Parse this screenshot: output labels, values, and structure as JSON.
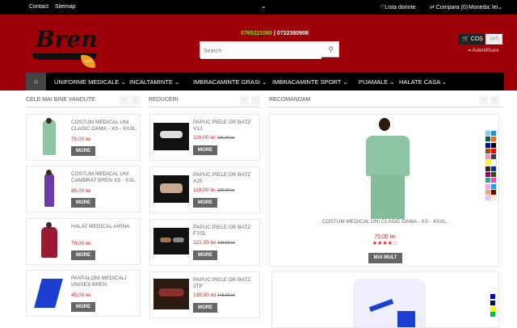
{
  "topbar": {
    "contact": "Contact",
    "sitemap": "Sitemap",
    "wishlist": "Lista dorinte",
    "compare": "Compara (0)",
    "currency": "Moneda: lei"
  },
  "header": {
    "logo_text": "Bren",
    "logo_badge": "MAG",
    "phone1": "0765221060",
    "phone_sep": " | ",
    "phone2": "0722380908",
    "search_placeholder": "Search",
    "cart_label": "COȘ",
    "cart_status": "(gol)",
    "login": "Autentificare"
  },
  "nav": {
    "items": [
      "UNIFORME MEDICALE",
      "INCALTAMINTE",
      "IMBRACAMINTE GRASI",
      "IMBRACAMINTE SPORT",
      "PIJAMALE",
      "HALATE CASA"
    ]
  },
  "bestsellers": {
    "title": "CELE MAI BINE VANDUTE",
    "items": [
      {
        "name": "COSTUM MEDICAL UNI CLASIC DAMA - XS - XXXL.",
        "price": "75,00 lei",
        "button": "MORE"
      },
      {
        "name": "COSTUM MEDICAL UNI CAMBRAT BREN XS - XXL",
        "price": "85,00 lei",
        "button": "MORE"
      },
      {
        "name": "HALAT MEDICAL IARNA",
        "price": "79,00 lei",
        "button": "MORE"
      },
      {
        "name": "PANTALONI MEDICALI UNISEX BREN",
        "price": "45,00 lei",
        "button": "MORE"
      }
    ]
  },
  "discounts": {
    "title": "REDUCERI",
    "items": [
      {
        "name": "PAPUC PIELE DR BATZ V13",
        "price": "116,00 lei",
        "old_price": "126,00 lei",
        "button": "MORE"
      },
      {
        "name": "PAPUC PIELE DR BATZ A25",
        "price": "118,00 lei",
        "old_price": "128,00 lei",
        "button": "MORE"
      },
      {
        "name": "PAPUC PIELE DR BATZ FT05",
        "price": "122,00 lei",
        "old_price": "132,00 lei",
        "button": "MORE"
      },
      {
        "name": "PAPUC PIELE DR BATZ 3TP",
        "price": "138,00 lei",
        "old_price": "148,00 lei",
        "button": "MORE"
      }
    ]
  },
  "recommended": {
    "title": "RECOMANDAM",
    "product": {
      "name": "COSTUM MEDICAL UNI CLASIC DAMA - XS - XXXL.",
      "price": "75,00 lei",
      "rating": 4,
      "rating_max": 5,
      "button": "MAI MULT",
      "colors": [
        "#8fc4f0",
        "#1a9ab8",
        "#006060",
        "#ff6020",
        "#0000c0",
        "#000000",
        "#a05000",
        "#ff0000",
        "#ff90b0",
        "#404040",
        "#ffff00",
        "#ffffff",
        "#402010",
        "#003090",
        "#a00080",
        "#305000",
        "#20b090",
        "#ff40c0",
        "#ffa0f0",
        "#00b0f0",
        "#ffa070",
        "#700000",
        "#d8c8f8",
        "#fff0c0"
      ]
    },
    "product2": {
      "colors": [
        "#ffffff",
        "#0000c0",
        "#001040",
        "#ffff00",
        "#00c040"
      ]
    }
  },
  "colors": {
    "header_red": "#9e0008",
    "price_red": "#d2232a",
    "button_grey": "#666666"
  }
}
